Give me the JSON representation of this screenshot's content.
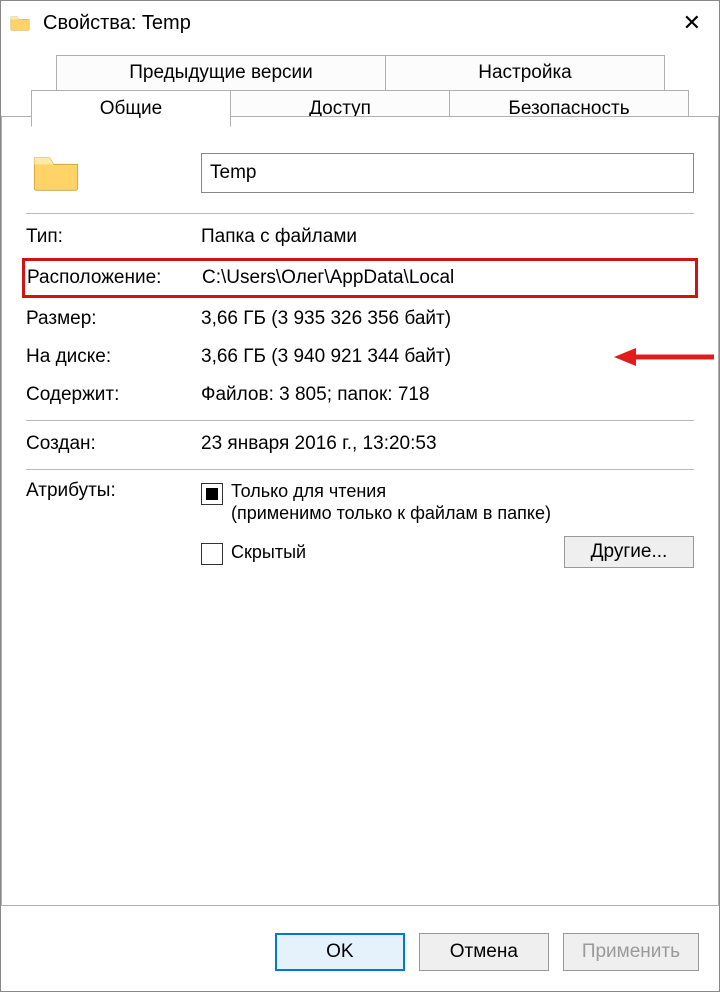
{
  "titlebar": {
    "title": "Свойства: Temp"
  },
  "tabs": {
    "prev_versions": "Предыдущие версии",
    "customize": "Настройка",
    "general": "Общие",
    "sharing": "Доступ",
    "security": "Безопасность"
  },
  "general": {
    "folder_name": "Temp",
    "type_label": "Тип:",
    "type_value": "Папка с файлами",
    "location_label": "Расположение:",
    "location_value": "C:\\Users\\Олег\\AppData\\Local",
    "size_label": "Размер:",
    "size_value": "3,66 ГБ (3 935 326 356 байт)",
    "size_on_disk_label": "На диске:",
    "size_on_disk_value": "3,66 ГБ (3 940 921 344 байт)",
    "contains_label": "Содержит:",
    "contains_value": "Файлов: 3 805; папок: 718",
    "created_label": "Создан:",
    "created_value": "23 января 2016 г., 13:20:53",
    "attributes_label": "Атрибуты:",
    "readonly_line1": "Только для чтения",
    "readonly_line2": "(применимо только к файлам в папке)",
    "hidden_label": "Скрытый",
    "others_button": "Другие..."
  },
  "buttons": {
    "ok": "OK",
    "cancel": "Отмена",
    "apply": "Применить"
  }
}
